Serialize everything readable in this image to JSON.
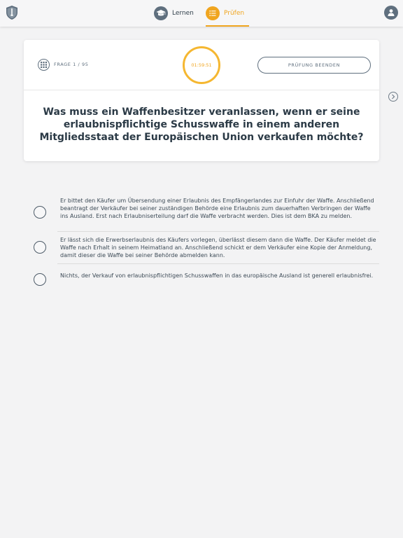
{
  "nav": {
    "learn_label": "Lernen",
    "exam_label": "Prüfen",
    "active_tab": "Prüfen",
    "accent_color": "#f0a51f",
    "icon_color": "#5f6f7e"
  },
  "exam": {
    "counter": "FRAGE 1 / 95",
    "timer": "01:59:51",
    "end_button": "PRÜFUNG BEENDEN",
    "question": "Was muss ein Waffenbesitzer veranlassen, wenn er seine erlaubnispflichtige Schusswaffe in einem anderen Mitgliedsstaat der Europäischen Union verkaufen möchte?"
  },
  "answers": [
    {
      "text": "Er bittet den Käufer um Übersendung einer Erlaubnis des Empfängerlandes zur Einfuhr der Waffe. Anschließend beantragt der Verkäufer bei seiner zuständigen Behörde eine Erlaubnis zum dauerhaften Verbringen der Waffe ins Ausland. Erst nach Erlaubniserteilung darf die Waffe verbracht werden. Dies ist dem BKA zu melden.",
      "selected": false
    },
    {
      "text": "Er lässt sich die Erwerbserlaubnis des Käufers vorlegen, überlässt diesem dann die Waffe. Der Käufer meldet die Waffe nach Erhalt in seinem Heimatland an. Anschließend schickt er dem Verkäufer eine Kopie der Anmeldung, damit dieser die Waffe bei seiner Behörde abmelden kann.",
      "selected": false
    },
    {
      "text": "Nichts, der Verkauf von erlaubnispflichtigen Schusswaffen in das europäische Ausland ist generell erlaubnisfrei.",
      "selected": false
    }
  ]
}
